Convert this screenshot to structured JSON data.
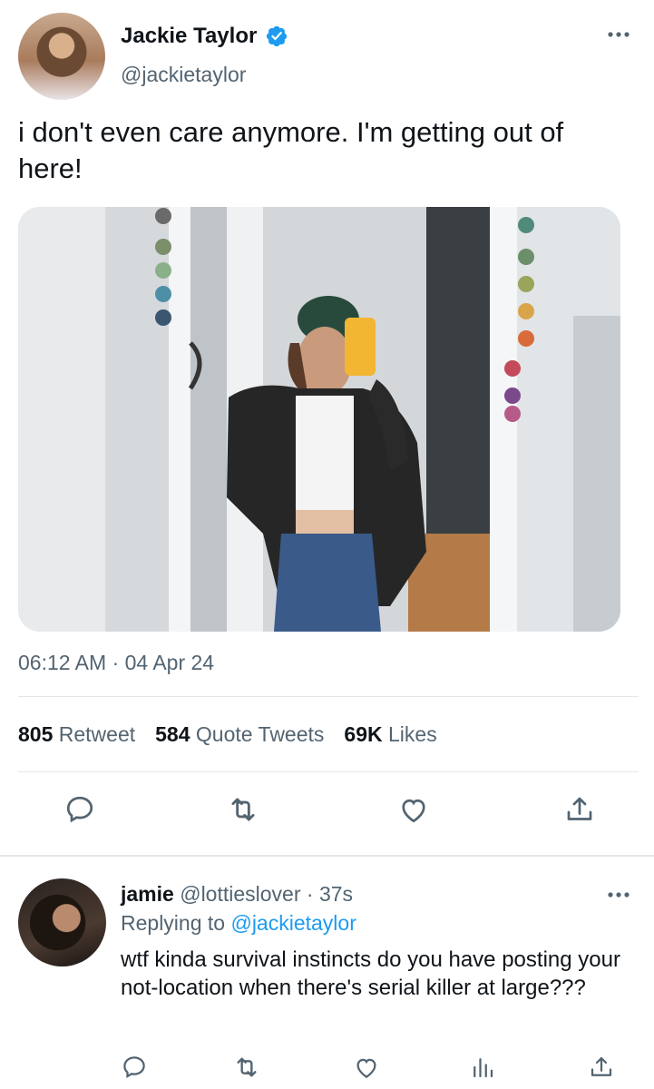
{
  "tweet": {
    "author_name": "Jackie Taylor",
    "author_handle": "@jackietaylor",
    "text": "i don't even care anymore. I'm getting out of here!",
    "timestamp": "06:12 AM · 04 Apr 24",
    "stats": {
      "retweets_count": "805",
      "retweets_label": "Retweet",
      "quotes_count": "584",
      "quotes_label": "Quote Tweets",
      "likes_count": "69K",
      "likes_label": "Likes"
    }
  },
  "reply": {
    "name": "jamie",
    "handle": "@lottieslover",
    "time": "· 37s",
    "replying_prefix": "Replying to",
    "replying_handle": "@jackietaylor",
    "text": "wtf kinda survival instincts do you have posting your not-location when there's serial killer at large???"
  },
  "colors": {
    "accent": "#1d9bf0",
    "secondary_text": "#536471",
    "primary_text": "#0f1419",
    "divider": "#e4e7ea"
  },
  "icons": [
    "verified-badge-icon",
    "more-icon",
    "reply-icon",
    "retweet-icon",
    "like-icon",
    "share-icon",
    "analytics-icon"
  ]
}
